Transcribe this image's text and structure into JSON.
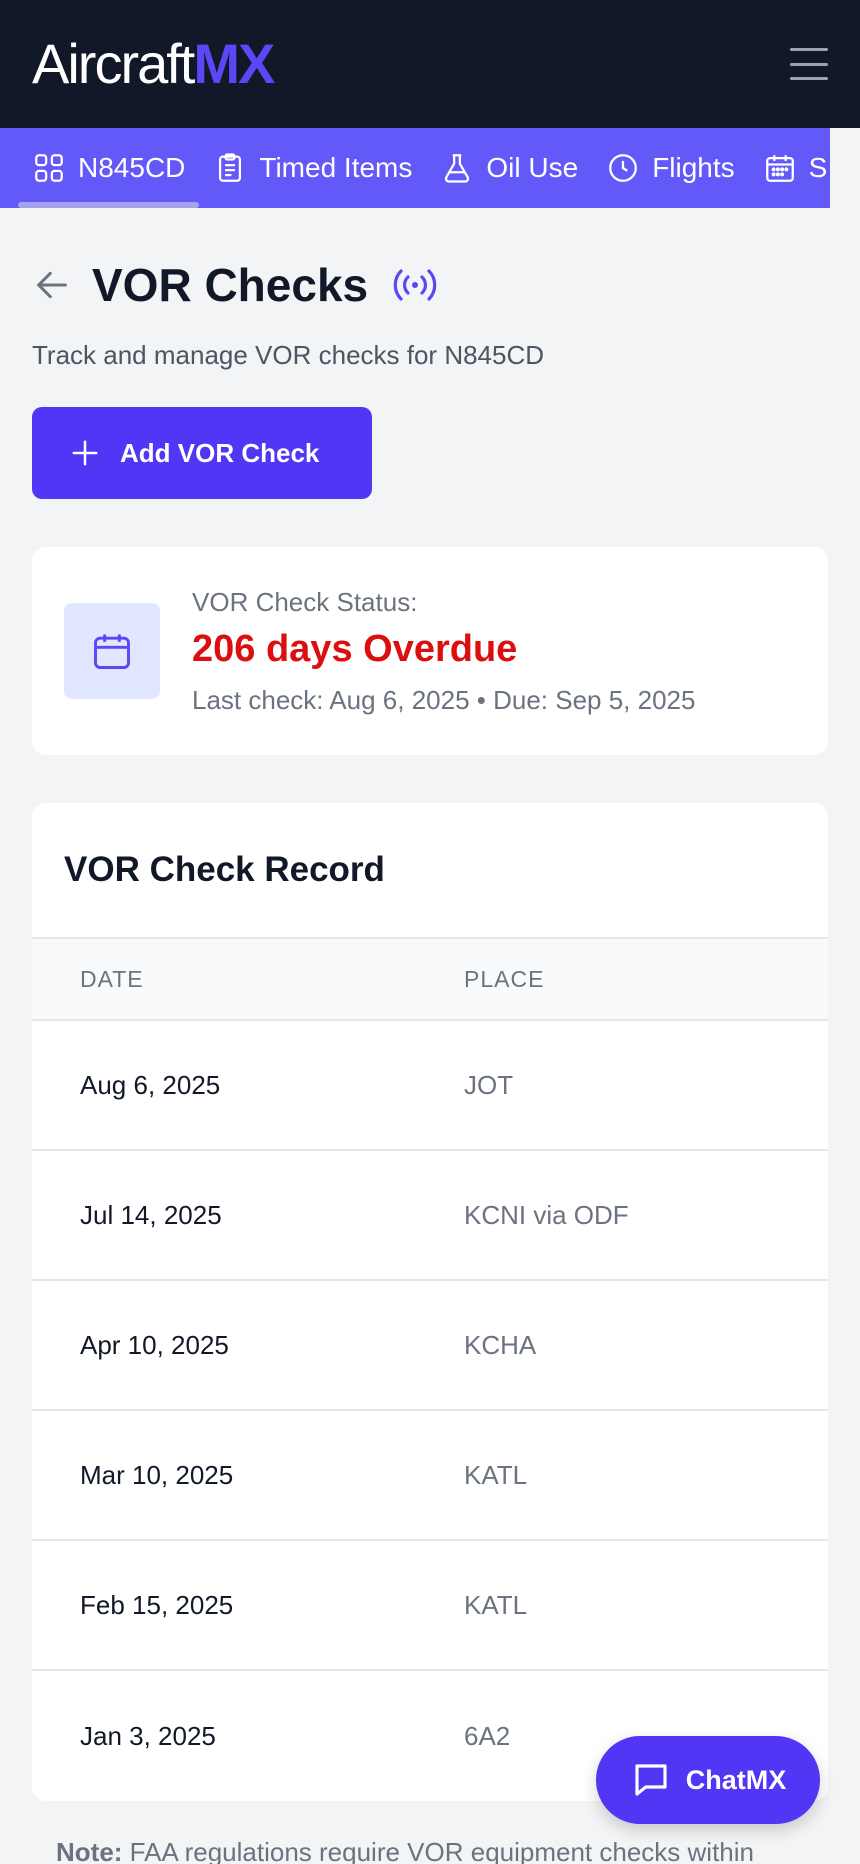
{
  "header": {
    "logo_text_1": "Aircraft",
    "logo_text_2": "MX",
    "menu_icon": "hamburger-menu-icon"
  },
  "tabs": [
    {
      "label": "N845CD",
      "icon": "grid-icon",
      "active": true
    },
    {
      "label": "Timed Items",
      "icon": "clipboard-icon",
      "active": false
    },
    {
      "label": "Oil Use",
      "icon": "flask-icon",
      "active": false
    },
    {
      "label": "Flights",
      "icon": "clock-icon",
      "active": false
    },
    {
      "label": "S",
      "icon": "calendar-icon",
      "active": false
    }
  ],
  "page": {
    "title": "VOR Checks",
    "subtitle": "Track and manage VOR checks for N845CD",
    "add_button_label": "Add VOR Check"
  },
  "status": {
    "label": "VOR Check Status:",
    "value": "206 days Overdue",
    "detail": "Last check: Aug 6, 2025 • Due: Sep 5, 2025"
  },
  "record": {
    "title": "VOR Check Record",
    "columns": [
      "DATE",
      "PLACE"
    ],
    "rows": [
      {
        "date": "Aug 6, 2025",
        "place": "JOT"
      },
      {
        "date": "Jul 14, 2025",
        "place": "KCNI via ODF"
      },
      {
        "date": "Apr 10, 2025",
        "place": "KCHA"
      },
      {
        "date": "Mar 10, 2025",
        "place": "KATL"
      },
      {
        "date": "Feb 15, 2025",
        "place": "KATL"
      },
      {
        "date": "Jan 3, 2025",
        "place": "6A2"
      }
    ]
  },
  "note": {
    "label": "Note:",
    "text": "FAA regulations require VOR equipment checks within"
  },
  "chat": {
    "label": "ChatMX"
  },
  "colors": {
    "topbar": "#111827",
    "tabbar": "#6358f8",
    "accent": "#5136f5",
    "overdue": "#dc0f0f"
  }
}
